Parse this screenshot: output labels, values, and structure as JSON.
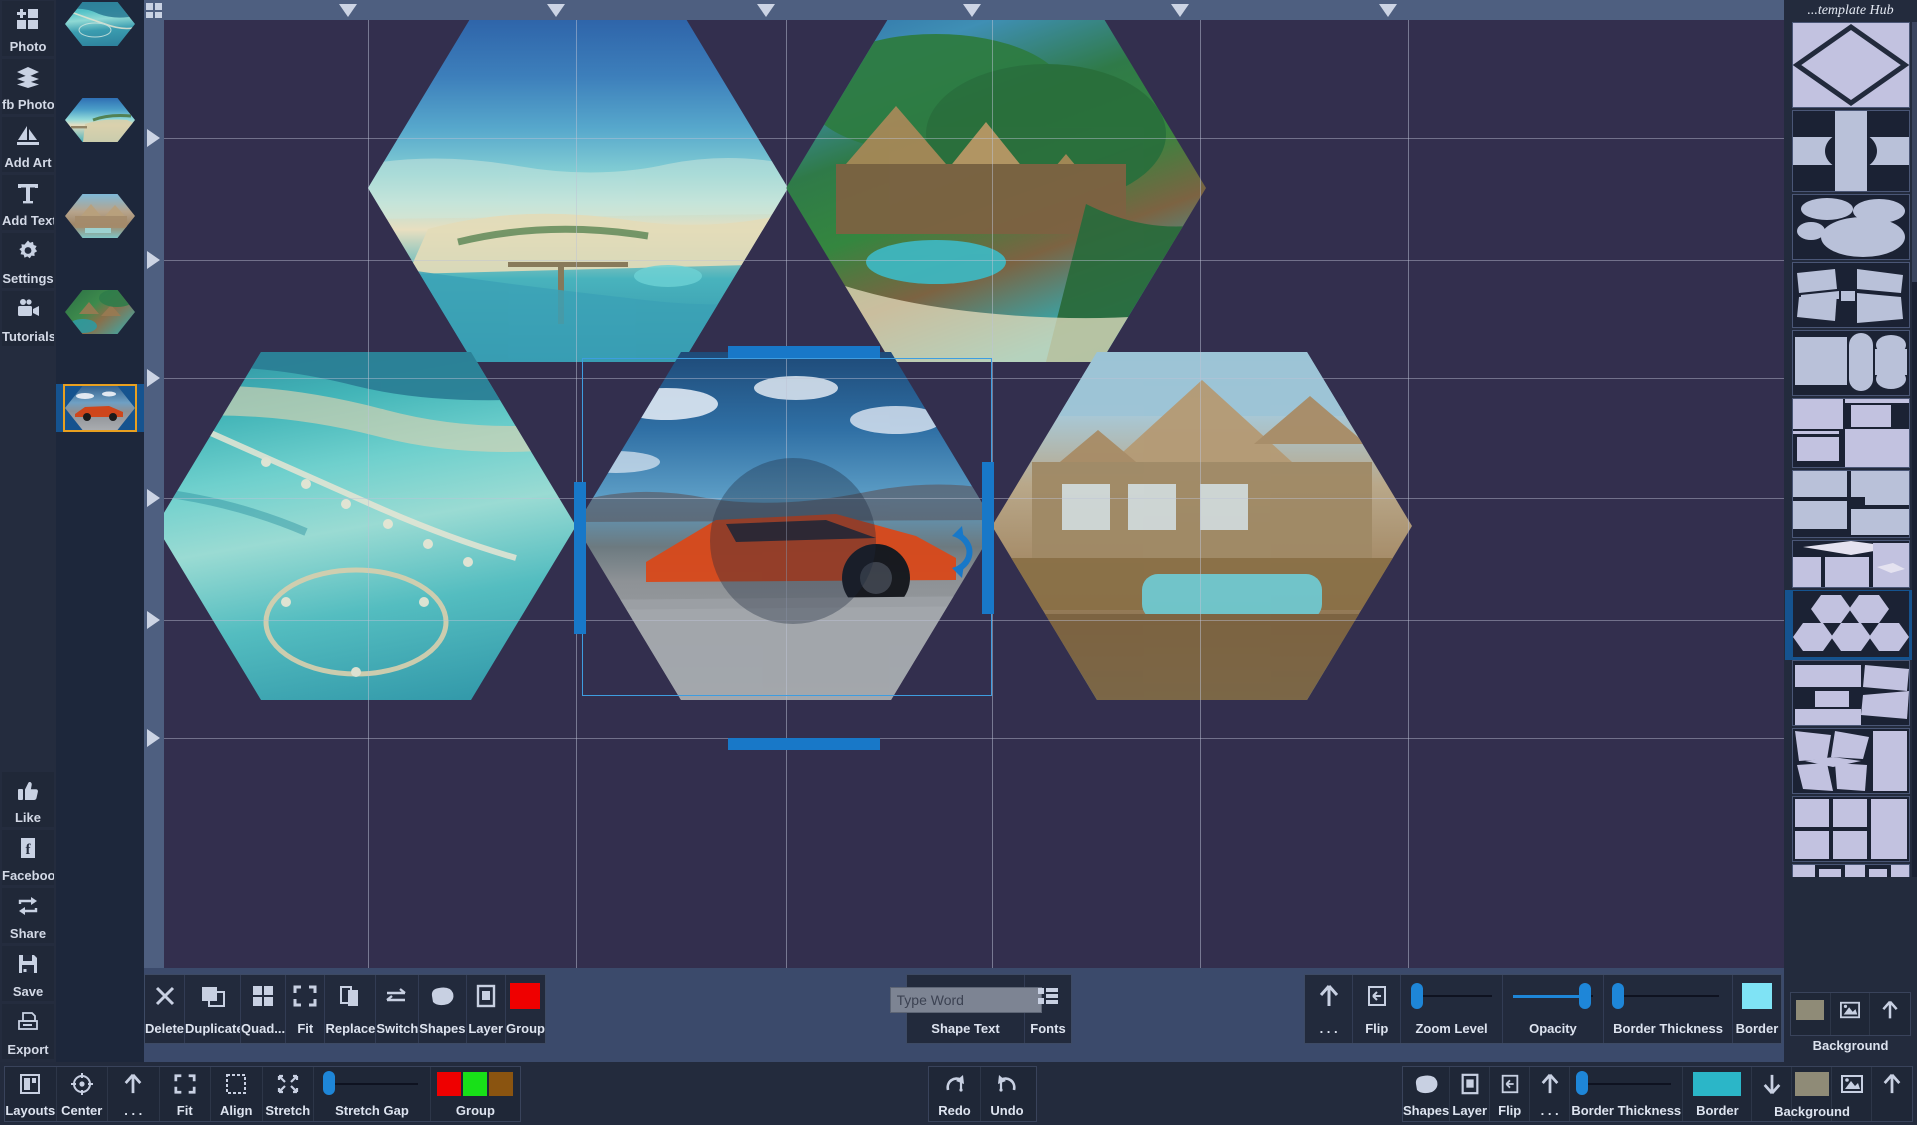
{
  "app": {
    "right_panel_title": "...template Hub"
  },
  "left_rail": {
    "top_items": [
      {
        "label": "Photo",
        "icon": "add-photo-icon"
      },
      {
        "label": "fb Photo",
        "icon": "layers-icon"
      },
      {
        "label": "Add Art",
        "icon": "sailboat-icon"
      },
      {
        "label": "Add Text",
        "icon": "text-t-icon"
      },
      {
        "label": "Settings",
        "icon": "gear-icon"
      },
      {
        "label": "Tutorials",
        "icon": "video-camera-icon"
      }
    ],
    "bottom_items": [
      {
        "label": "Like",
        "icon": "thumbs-up-icon"
      },
      {
        "label": "Facebook",
        "icon": "facebook-f-icon"
      },
      {
        "label": "Share",
        "icon": "share-icon"
      },
      {
        "label": "Save",
        "icon": "floppy-disk-icon"
      },
      {
        "label": "Export",
        "icon": "printer-icon"
      }
    ]
  },
  "photo_strip": {
    "thumbs": [
      {
        "name": "atoll-aerial",
        "selected": false
      },
      {
        "name": "beach-island",
        "selected": false
      },
      {
        "name": "overwater-villa",
        "selected": false
      },
      {
        "name": "jungle-resort",
        "selected": false
      },
      {
        "name": "orange-supercar",
        "selected": true
      }
    ]
  },
  "canvas": {
    "cells": [
      {
        "name": "cell-top-left",
        "photo": "beach-island"
      },
      {
        "name": "cell-top-right",
        "photo": "jungle-resort"
      },
      {
        "name": "cell-bottom-left",
        "photo": "atoll-aerial"
      },
      {
        "name": "cell-bottom-center",
        "photo": "orange-supercar",
        "selected": true
      },
      {
        "name": "cell-bottom-right",
        "photo": "overwater-villa"
      }
    ]
  },
  "toolbar": {
    "edit_group": [
      {
        "label": "Delete",
        "icon": "x-close-icon"
      },
      {
        "label": "Duplicate",
        "icon": "copy-icon"
      },
      {
        "label": "Quad...",
        "icon": "grid-4-icon"
      },
      {
        "label": "Fit",
        "icon": "fit-corners-icon"
      },
      {
        "label": "Replace",
        "icon": "pages-icon"
      },
      {
        "label": "Switch",
        "icon": "swap-arrows-icon"
      },
      {
        "label": "Shapes",
        "icon": "blob-shape-icon"
      },
      {
        "label": "Layer",
        "icon": "square-in-square-icon"
      },
      {
        "label": "Group",
        "icon": "color-swatch-icon",
        "color": "#ef0000"
      }
    ],
    "text_group": [
      {
        "label": "Shape Text",
        "icon": "text-input-icon",
        "placeholder": "Type Word",
        "value": ""
      },
      {
        "label": "Fonts",
        "icon": "font-list-icon"
      }
    ],
    "props_group": [
      {
        "label": ". . .",
        "icon": "arrow-up-icon"
      },
      {
        "label": "Flip",
        "icon": "flip-icon"
      },
      {
        "label": "Zoom Level",
        "icon": "slider-icon",
        "value": 3
      },
      {
        "label": "Opacity",
        "icon": "slider-icon",
        "value": 92
      },
      {
        "label": "Border Thickness",
        "icon": "slider-icon",
        "value": 4
      },
      {
        "label": "Border",
        "icon": "color-swatch-icon",
        "color": "#7fe3f5"
      }
    ]
  },
  "statusbar": {
    "left_group": [
      {
        "label": "Layouts",
        "icon": "layouts-icon"
      },
      {
        "label": "Center",
        "icon": "crosshair-icon"
      },
      {
        "label": ". . .",
        "icon": "arrow-up-icon"
      },
      {
        "label": "Fit",
        "icon": "fit-corners-icon"
      },
      {
        "label": "Align",
        "icon": "align-frame-icon"
      },
      {
        "label": "Stretch",
        "icon": "stretch-arrows-icon"
      },
      {
        "label": "Stretch Gap",
        "icon": "slider-icon",
        "value": 6
      },
      {
        "label": "Group",
        "icon": "color-swatches-icon",
        "colors": [
          "#ef0000",
          "#18e018",
          "#8a5410"
        ]
      }
    ],
    "center_group": [
      {
        "label": "Redo",
        "icon": "redo-arrow-icon"
      },
      {
        "label": "Undo",
        "icon": "undo-arrow-icon"
      }
    ],
    "right_group": [
      {
        "label": "Shapes",
        "icon": "blob-shape-icon"
      },
      {
        "label": "Layer",
        "icon": "square-in-square-icon"
      },
      {
        "label": "Flip",
        "icon": "flip-icon"
      },
      {
        "label": ". . .",
        "icon": "arrow-up-icon"
      },
      {
        "label": "Border Thickness",
        "icon": "slider-icon",
        "value": 4
      },
      {
        "label": "Border",
        "icon": "color-swatch-icon",
        "color": "#2bb6c8"
      },
      {
        "label": "Background",
        "icon": "arrow-down-icon"
      }
    ],
    "background_group": [
      {
        "icon": "color-swatch-icon",
        "color": "#8f8b77"
      },
      {
        "icon": "image-icon"
      },
      {
        "icon": "arrow-up-icon"
      }
    ]
  },
  "right_panel": {
    "background_label": "Background",
    "background_items": [
      {
        "icon": "color-swatch-icon",
        "color": "#8f8b77"
      },
      {
        "icon": "image-icon"
      },
      {
        "icon": "arrow-up-icon"
      }
    ],
    "templates": [
      {
        "name": "tpl-diamond",
        "selected": false
      },
      {
        "name": "tpl-checker-ellipse",
        "selected": false
      },
      {
        "name": "tpl-ellipses",
        "selected": false
      },
      {
        "name": "tpl-pinwheel",
        "selected": false
      },
      {
        "name": "tpl-rect-capsules",
        "selected": false
      },
      {
        "name": "tpl-stepped-blocks",
        "selected": false
      },
      {
        "name": "tpl-split-grid",
        "selected": false
      },
      {
        "name": "tpl-diamond-strip",
        "selected": false
      },
      {
        "name": "tpl-hexagons",
        "selected": true
      },
      {
        "name": "tpl-bars-tilted",
        "selected": false
      },
      {
        "name": "tpl-bowtie",
        "selected": false
      },
      {
        "name": "tpl-grid-six",
        "selected": false
      },
      {
        "name": "tpl-columns",
        "selected": false
      },
      {
        "name": "tpl-l-strip",
        "selected": false
      },
      {
        "name": "tpl-wide-strip",
        "selected": false
      }
    ]
  },
  "colors": {
    "accent_blue": "#1878c8",
    "canvas_bg": "#332f4e",
    "panel_bg": "#232b3d",
    "rail_bg": "#242c3e",
    "select_orange": "#e8a020",
    "select_blue": "#15538f"
  }
}
